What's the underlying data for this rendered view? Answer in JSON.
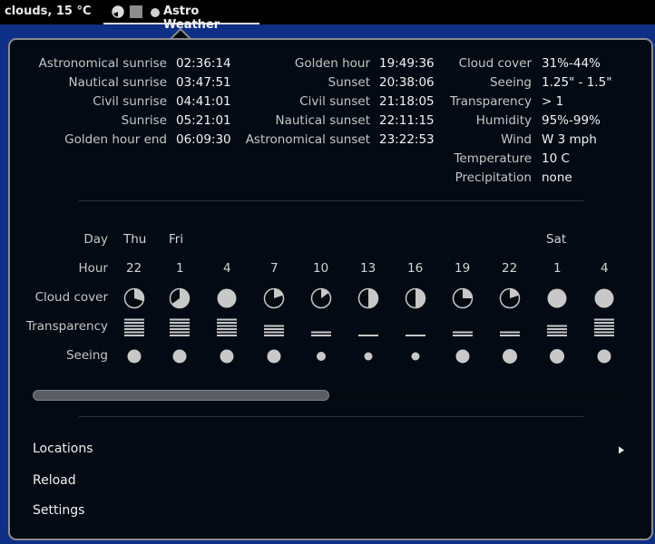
{
  "topbar": {
    "status": "clouds, 15 °C",
    "indicator_title": "Astro Weather"
  },
  "times": {
    "col1": [
      {
        "label": "Astronomical sunrise",
        "value": "02:36:14"
      },
      {
        "label": "Nautical sunrise",
        "value": "03:47:51"
      },
      {
        "label": "Civil sunrise",
        "value": "04:41:01"
      },
      {
        "label": "Sunrise",
        "value": "05:21:01"
      },
      {
        "label": "Golden hour end",
        "value": "06:09:30"
      }
    ],
    "col2": [
      {
        "label": "Golden hour",
        "value": "19:49:36"
      },
      {
        "label": "Sunset",
        "value": "20:38:06"
      },
      {
        "label": "Civil sunset",
        "value": "21:18:05"
      },
      {
        "label": "Nautical sunset",
        "value": "22:11:15"
      },
      {
        "label": "Astronomical sunset",
        "value": "23:22:53"
      }
    ]
  },
  "conditions": [
    {
      "label": "Cloud cover",
      "value": "31%-44%"
    },
    {
      "label": "Seeing",
      "value": "1.25\" - 1.5\""
    },
    {
      "label": "Transparency",
      "value": "> 1"
    },
    {
      "label": "Humidity",
      "value": "95%-99%"
    },
    {
      "label": "Wind",
      "value": "W 3 mph"
    },
    {
      "label": "Temperature",
      "value": "10 C"
    },
    {
      "label": "Precipitation",
      "value": "none"
    }
  ],
  "forecast": {
    "row_labels": {
      "day": "Day",
      "hour": "Hour",
      "cloud": "Cloud cover",
      "transparency": "Transparency",
      "seeing": "Seeing"
    },
    "columns": [
      {
        "day": "Thu",
        "hour": "22",
        "cloud": 0.3,
        "transp": 6,
        "seeing": 0.75
      },
      {
        "day": "Fri",
        "hour": "1",
        "cloud": 0.65,
        "transp": 6,
        "seeing": 0.75
      },
      {
        "day": "",
        "hour": "4",
        "cloud": 1.0,
        "transp": 6,
        "seeing": 0.75
      },
      {
        "day": "",
        "hour": "7",
        "cloud": 0.2,
        "transp": 4,
        "seeing": 0.75
      },
      {
        "day": "",
        "hour": "10",
        "cloud": 0.15,
        "transp": 2,
        "seeing": 0.5
      },
      {
        "day": "",
        "hour": "13",
        "cloud": 0.5,
        "transp": 1,
        "seeing": 0.45
      },
      {
        "day": "",
        "hour": "16",
        "cloud": 0.5,
        "transp": 1,
        "seeing": 0.45
      },
      {
        "day": "",
        "hour": "19",
        "cloud": 0.25,
        "transp": 2,
        "seeing": 0.75
      },
      {
        "day": "",
        "hour": "22",
        "cloud": 0.2,
        "transp": 2,
        "seeing": 0.8
      },
      {
        "day": "Sat",
        "hour": "1",
        "cloud": 1.0,
        "transp": 4,
        "seeing": 0.8
      },
      {
        "day": "",
        "hour": "4",
        "cloud": 1.0,
        "transp": 6,
        "seeing": 0.75
      }
    ]
  },
  "menu": {
    "locations": "Locations",
    "reload": "Reload",
    "settings": "Settings"
  },
  "colors": {
    "panel": "#030a13",
    "desktop": "#0d2f86",
    "icon": "#c8c8c8"
  }
}
